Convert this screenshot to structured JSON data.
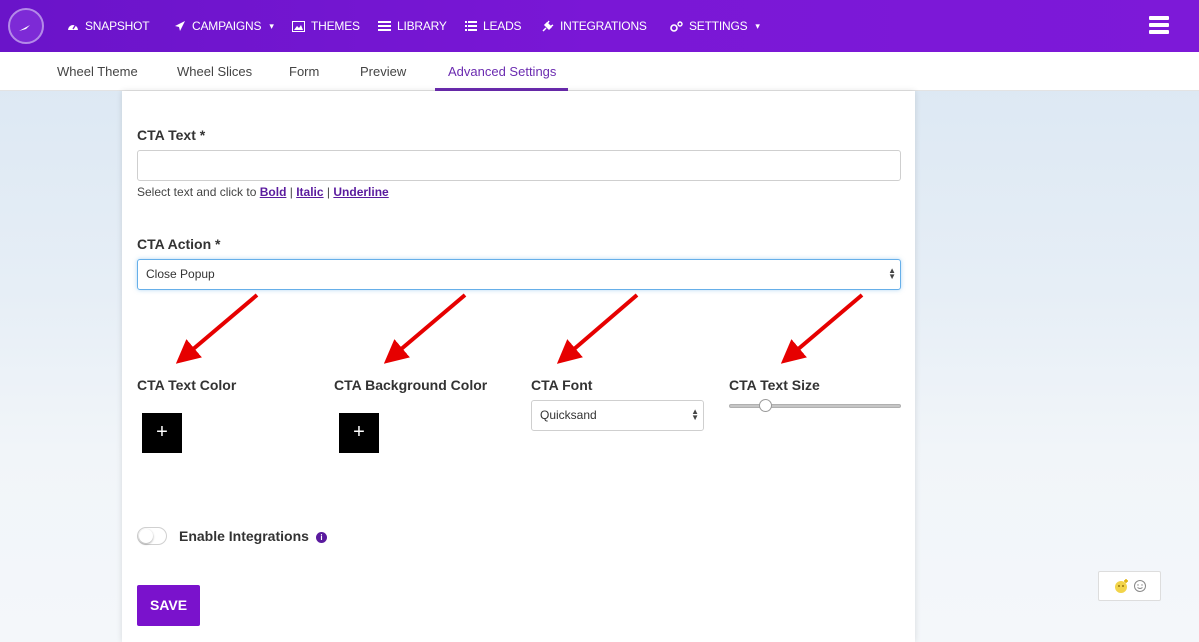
{
  "navbar": {
    "items": [
      {
        "label": "SNAPSHOT",
        "icon": "dashboard-icon"
      },
      {
        "label": "CAMPAIGNS",
        "icon": "paper-plane-icon",
        "dropdown": true
      },
      {
        "label": "THEMES",
        "icon": "image-icon"
      },
      {
        "label": "LIBRARY",
        "icon": "library-icon"
      },
      {
        "label": "LEADS",
        "icon": "list-icon"
      },
      {
        "label": "INTEGRATIONS",
        "icon": "plug-icon"
      },
      {
        "label": "SETTINGS",
        "icon": "cogs-icon",
        "dropdown": true
      }
    ],
    "caret": "▾"
  },
  "subtabs": {
    "items": [
      "Wheel Theme",
      "Wheel Slices",
      "Form",
      "Preview",
      "Advanced Settings"
    ],
    "active": "Advanced Settings"
  },
  "form": {
    "cta_text": {
      "label": "CTA Text *",
      "value": "",
      "helper_prefix": "Select text and click to",
      "bold": "Bold",
      "italic": "Italic",
      "underline": "Underline",
      "sep": "|"
    },
    "cta_action": {
      "label": "CTA Action *",
      "value": "Close Popup"
    },
    "cta_text_color": {
      "label": "CTA Text Color",
      "button": "+"
    },
    "cta_bg_color": {
      "label": "CTA Background Color",
      "button": "+"
    },
    "cta_font": {
      "label": "CTA Font",
      "value": "Quicksand"
    },
    "cta_text_size": {
      "label": "CTA Text Size",
      "slider_level": 0.17
    },
    "integrations": {
      "label": "Enable Integrations",
      "enabled": false,
      "info": "i"
    },
    "save": "SAVE"
  },
  "colors": {
    "nav_purple": "#7a17d6",
    "accent_purple": "#6b2bb0",
    "save_purple": "#7a12cc",
    "arrow_red": "#e60000"
  }
}
